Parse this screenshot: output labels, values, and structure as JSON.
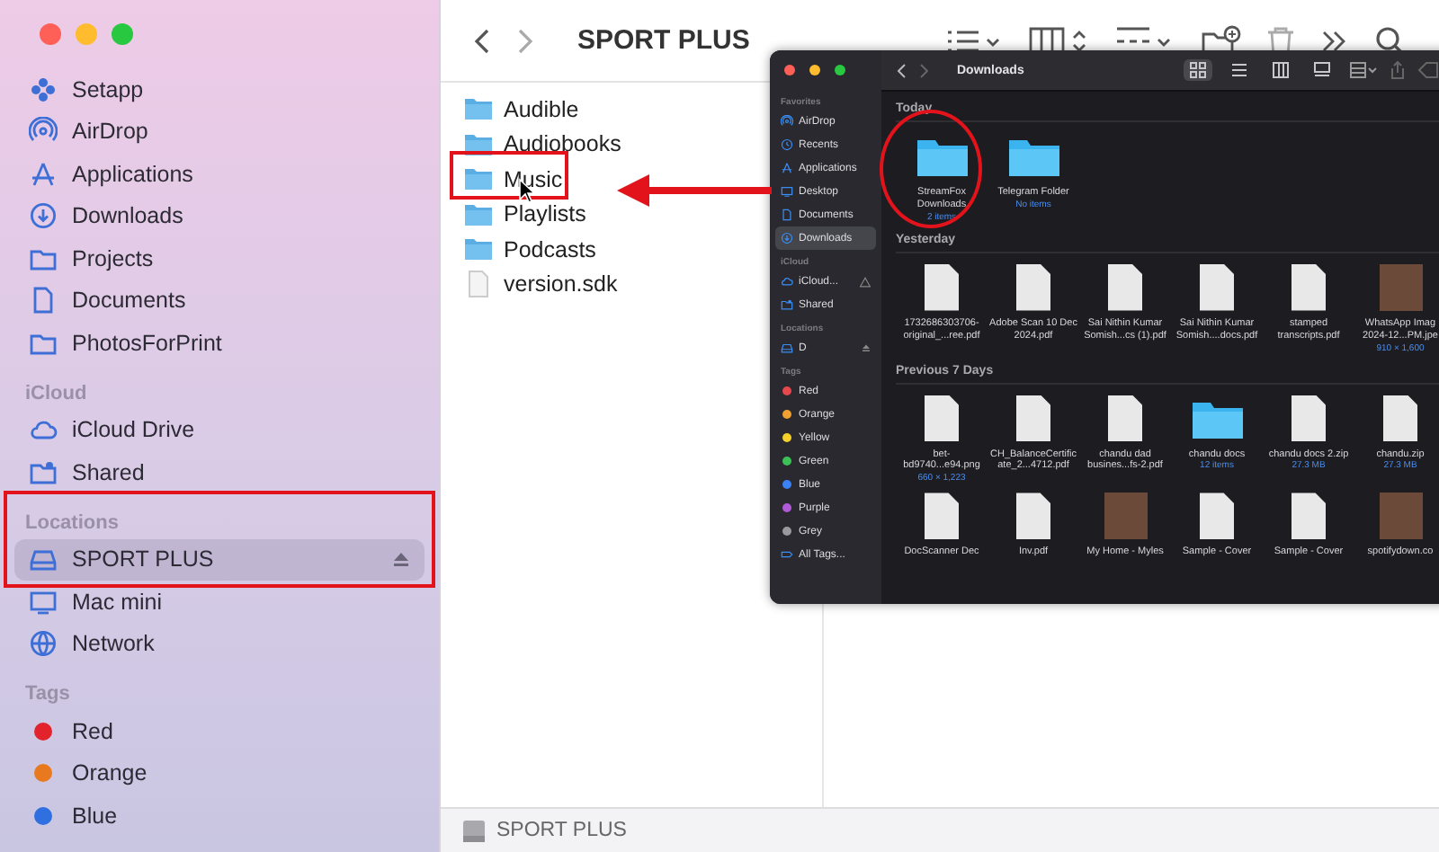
{
  "main_window": {
    "sidebar": {
      "groups": [
        {
          "items": [
            {
              "label": "Setapp",
              "kind": "setapp",
              "selected": false,
              "eject": false
            },
            {
              "label": "AirDrop",
              "kind": "airdrop",
              "selected": false,
              "eject": false
            },
            {
              "label": "Applications",
              "kind": "applications",
              "selected": false,
              "eject": false
            },
            {
              "label": "Downloads",
              "kind": "downloads",
              "selected": false,
              "eject": false
            },
            {
              "label": "Projects",
              "kind": "folder",
              "selected": false,
              "eject": false
            },
            {
              "label": "Documents",
              "kind": "document",
              "selected": false,
              "eject": false
            },
            {
              "label": "PhotosForPrint",
              "kind": "folder",
              "selected": false,
              "eject": false
            }
          ]
        },
        {
          "header": "iCloud",
          "items": [
            {
              "label": "iCloud Drive",
              "kind": "cloud",
              "selected": false,
              "eject": false
            },
            {
              "label": "Shared",
              "kind": "shared",
              "selected": false,
              "eject": false
            }
          ]
        },
        {
          "header": "Locations",
          "items": [
            {
              "label": "SPORT PLUS",
              "kind": "drive",
              "selected": true,
              "eject": true
            },
            {
              "label": "Mac mini",
              "kind": "computer",
              "selected": false,
              "eject": false
            },
            {
              "label": "Network",
              "kind": "network",
              "selected": false,
              "eject": false
            }
          ]
        },
        {
          "header": "Tags",
          "items": [
            {
              "label": "Red",
              "kind": "tag",
              "color": "#e3232c",
              "selected": false,
              "eject": false
            },
            {
              "label": "Orange",
              "kind": "tag",
              "color": "#e8791f",
              "selected": false,
              "eject": false
            },
            {
              "label": "Blue",
              "kind": "tag",
              "color": "#2f6fe0",
              "selected": false,
              "eject": false
            }
          ]
        }
      ]
    },
    "toolbar": {
      "title": "SPORT PLUS"
    },
    "files": [
      {
        "name": "Audible",
        "kind": "folder",
        "selected": false
      },
      {
        "name": "Audiobooks",
        "kind": "folder",
        "selected": false
      },
      {
        "name": "Music",
        "kind": "folder",
        "selected": false
      },
      {
        "name": "Playlists",
        "kind": "folder",
        "selected": false
      },
      {
        "name": "Podcasts",
        "kind": "folder",
        "selected": false
      },
      {
        "name": "version.sdk",
        "kind": "document",
        "selected": false
      }
    ],
    "status_bar": {
      "path": "SPORT PLUS"
    }
  },
  "downloads_window": {
    "title": "Downloads",
    "views": [
      {
        "kind": "grid",
        "selected": true
      },
      {
        "kind": "list",
        "selected": false
      },
      {
        "kind": "columns",
        "selected": false
      },
      {
        "kind": "gallery",
        "selected": false
      }
    ],
    "sidebar": {
      "groups": [
        {
          "header": "Favorites",
          "items": [
            {
              "label": "AirDrop",
              "kind": "airdrop",
              "selected": false,
              "eject": false,
              "warning": false
            },
            {
              "label": "Recents",
              "kind": "recents",
              "selected": false,
              "eject": false,
              "warning": false
            },
            {
              "label": "Applications",
              "kind": "applications",
              "selected": false,
              "eject": false,
              "warning": false
            },
            {
              "label": "Desktop",
              "kind": "computer",
              "selected": false,
              "eject": false,
              "warning": false
            },
            {
              "label": "Documents",
              "kind": "document",
              "selected": false,
              "eject": false,
              "warning": false
            },
            {
              "label": "Downloads",
              "kind": "downloads",
              "selected": true,
              "eject": false,
              "warning": false
            }
          ]
        },
        {
          "header": "iCloud",
          "items": [
            {
              "label": "iCloud...",
              "kind": "cloud",
              "selected": false,
              "eject": false,
              "warning": true
            },
            {
              "label": "Shared",
              "kind": "shared",
              "selected": false,
              "eject": false,
              "warning": false
            }
          ]
        },
        {
          "header": "Locations",
          "items": [
            {
              "label": "D",
              "kind": "drive",
              "selected": false,
              "eject": true,
              "warning": false
            }
          ]
        },
        {
          "header": "Tags",
          "items": [
            {
              "label": "Red",
              "kind": "tag",
              "color": "#e5484d",
              "selected": false,
              "eject": false,
              "warning": false
            },
            {
              "label": "Orange",
              "kind": "tag",
              "color": "#f0a030",
              "selected": false,
              "eject": false,
              "warning": false
            },
            {
              "label": "Yellow",
              "kind": "tag",
              "color": "#f5d02a",
              "selected": false,
              "eject": false,
              "warning": false
            },
            {
              "label": "Green",
              "kind": "tag",
              "color": "#3cc156",
              "selected": false,
              "eject": false,
              "warning": false
            },
            {
              "label": "Blue",
              "kind": "tag",
              "color": "#3b82f6",
              "selected": false,
              "eject": false,
              "warning": false
            },
            {
              "label": "Purple",
              "kind": "tag",
              "color": "#b05ad8",
              "selected": false,
              "eject": false,
              "warning": false
            },
            {
              "label": "Grey",
              "kind": "tag",
              "color": "#9a9a9e",
              "selected": false,
              "eject": false,
              "warning": false
            },
            {
              "label": "All Tags...",
              "kind": "all-tags",
              "selected": false,
              "eject": false,
              "warning": false
            }
          ]
        }
      ]
    },
    "sections": [
      {
        "title": "Today",
        "items": [
          {
            "name": "StreamFox Downloads",
            "kind": "folder",
            "info": "2 items"
          },
          {
            "name": "Telegram Folder",
            "kind": "folder",
            "info": "No items"
          }
        ]
      },
      {
        "title": "Yesterday",
        "items": [
          {
            "name": "1732686303706-original_...ree.pdf",
            "kind": "document"
          },
          {
            "name": "Adobe Scan 10 Dec 2024.pdf",
            "kind": "document"
          },
          {
            "name": "Sai Nithin Kumar Somish...cs (1).pdf",
            "kind": "document"
          },
          {
            "name": "Sai Nithin Kumar Somish....docs.pdf",
            "kind": "document"
          },
          {
            "name": "stamped transcripts.pdf",
            "kind": "document"
          },
          {
            "name": "WhatsApp Imag 2024-12...PM.jpe",
            "kind": "image",
            "info": "910 × 1,600"
          }
        ]
      },
      {
        "title": "Previous 7 Days",
        "items": [
          {
            "name": "bet-bd9740...e94.png",
            "kind": "document",
            "info": "660 × 1,223"
          },
          {
            "name": "CH_BalanceCertificate_2...4712.pdf",
            "kind": "document"
          },
          {
            "name": "chandu dad busines...fs-2.pdf",
            "kind": "document"
          },
          {
            "name": "chandu docs",
            "kind": "folder",
            "info": "12 items"
          },
          {
            "name": "chandu docs 2.zip",
            "kind": "document",
            "info": "27.3 MB"
          },
          {
            "name": "chandu.zip",
            "kind": "document",
            "info": "27.3 MB"
          },
          {
            "name": "DocScanner Dec",
            "kind": "document"
          },
          {
            "name": "Inv.pdf",
            "kind": "document"
          },
          {
            "name": "My Home - Myles",
            "kind": "image"
          },
          {
            "name": "Sample - Cover",
            "kind": "document"
          },
          {
            "name": "Sample - Cover",
            "kind": "document"
          },
          {
            "name": "spotifydown.co",
            "kind": "image"
          }
        ]
      }
    ]
  }
}
